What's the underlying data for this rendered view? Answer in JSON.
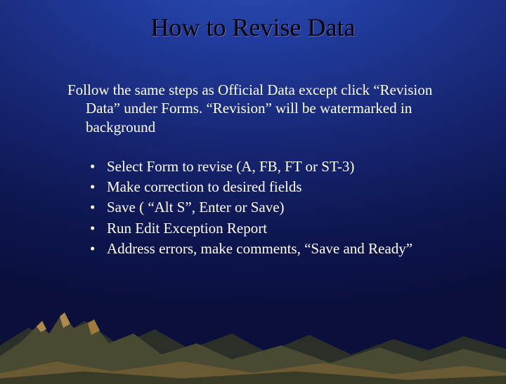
{
  "title": "How to Revise Data",
  "paragraph": "Follow the same steps as Official Data  except click “Revision Data” under Forms. “Revision” will be watermarked in background",
  "bullets": [
    "Select Form to revise (A, FB, FT or ST-3)",
    "Make correction to desired fields",
    "Save ( “Alt S”, Enter or Save)",
    "Run Edit Exception Report",
    "Address errors, make comments, “Save and Ready”"
  ]
}
